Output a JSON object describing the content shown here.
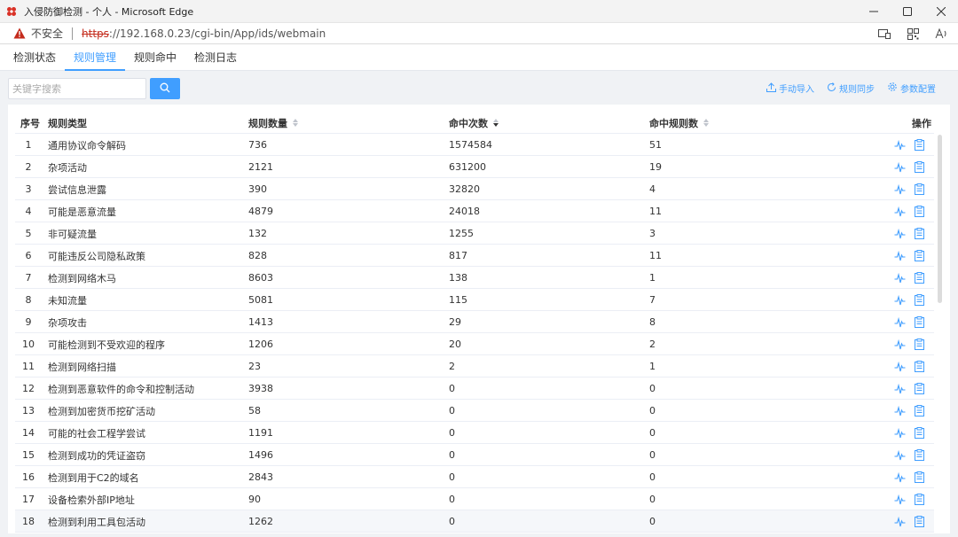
{
  "window": {
    "title": "入侵防御检测 - 个人 - Microsoft Edge"
  },
  "address_bar": {
    "security_label": "不安全",
    "url_scheme": "https",
    "url_rest": "://192.168.0.23/cgi-bin/App/ids/webmain"
  },
  "nav_tabs": [
    {
      "label": "检测状态",
      "active": false
    },
    {
      "label": "规则管理",
      "active": true
    },
    {
      "label": "规则命中",
      "active": false
    },
    {
      "label": "检测日志",
      "active": false
    }
  ],
  "toolbar": {
    "search_placeholder": "关键字搜索",
    "import_label": "手动导入",
    "sync_label": "规则同步",
    "config_label": "参数配置"
  },
  "table": {
    "headers": {
      "index": "序号",
      "type": "规则类型",
      "count": "规则数量",
      "hits": "命中次数",
      "hit_rules": "命中规则数",
      "ops": "操作"
    },
    "sorted_column": "hits",
    "sort_direction": "desc",
    "rows": [
      {
        "index": "1",
        "type": "通用协议命令解码",
        "count": "736",
        "hits": "1574584",
        "hit_rules": "51"
      },
      {
        "index": "2",
        "type": "杂项活动",
        "count": "2121",
        "hits": "631200",
        "hit_rules": "19"
      },
      {
        "index": "3",
        "type": "尝试信息泄露",
        "count": "390",
        "hits": "32820",
        "hit_rules": "4"
      },
      {
        "index": "4",
        "type": "可能是恶意流量",
        "count": "4879",
        "hits": "24018",
        "hit_rules": "11"
      },
      {
        "index": "5",
        "type": "非可疑流量",
        "count": "132",
        "hits": "1255",
        "hit_rules": "3"
      },
      {
        "index": "6",
        "type": "可能违反公司隐私政策",
        "count": "828",
        "hits": "817",
        "hit_rules": "11"
      },
      {
        "index": "7",
        "type": "检测到网络木马",
        "count": "8603",
        "hits": "138",
        "hit_rules": "1"
      },
      {
        "index": "8",
        "type": "未知流量",
        "count": "5081",
        "hits": "115",
        "hit_rules": "7"
      },
      {
        "index": "9",
        "type": "杂项攻击",
        "count": "1413",
        "hits": "29",
        "hit_rules": "8"
      },
      {
        "index": "10",
        "type": "可能检测到不受欢迎的程序",
        "count": "1206",
        "hits": "20",
        "hit_rules": "2"
      },
      {
        "index": "11",
        "type": "检测到网络扫描",
        "count": "23",
        "hits": "2",
        "hit_rules": "1"
      },
      {
        "index": "12",
        "type": "检测到恶意软件的命令和控制活动",
        "count": "3938",
        "hits": "0",
        "hit_rules": "0"
      },
      {
        "index": "13",
        "type": "检测到加密货币挖矿活动",
        "count": "58",
        "hits": "0",
        "hit_rules": "0"
      },
      {
        "index": "14",
        "type": "可能的社会工程学尝试",
        "count": "1191",
        "hits": "0",
        "hit_rules": "0"
      },
      {
        "index": "15",
        "type": "检测到成功的凭证盗窃",
        "count": "1496",
        "hits": "0",
        "hit_rules": "0"
      },
      {
        "index": "16",
        "type": "检测到用于C2的域名",
        "count": "2843",
        "hits": "0",
        "hit_rules": "0"
      },
      {
        "index": "17",
        "type": "设备检索外部IP地址",
        "count": "90",
        "hits": "0",
        "hit_rules": "0"
      },
      {
        "index": "18",
        "type": "检测到利用工具包活动",
        "count": "1262",
        "hits": "0",
        "hit_rules": "0"
      }
    ],
    "hovered_row": 18
  },
  "colors": {
    "accent": "#409eff",
    "insecure": "#c42b1c"
  },
  "icons": {
    "row_op_1": "activity-pulse-icon",
    "row_op_2": "clipboard-icon"
  }
}
